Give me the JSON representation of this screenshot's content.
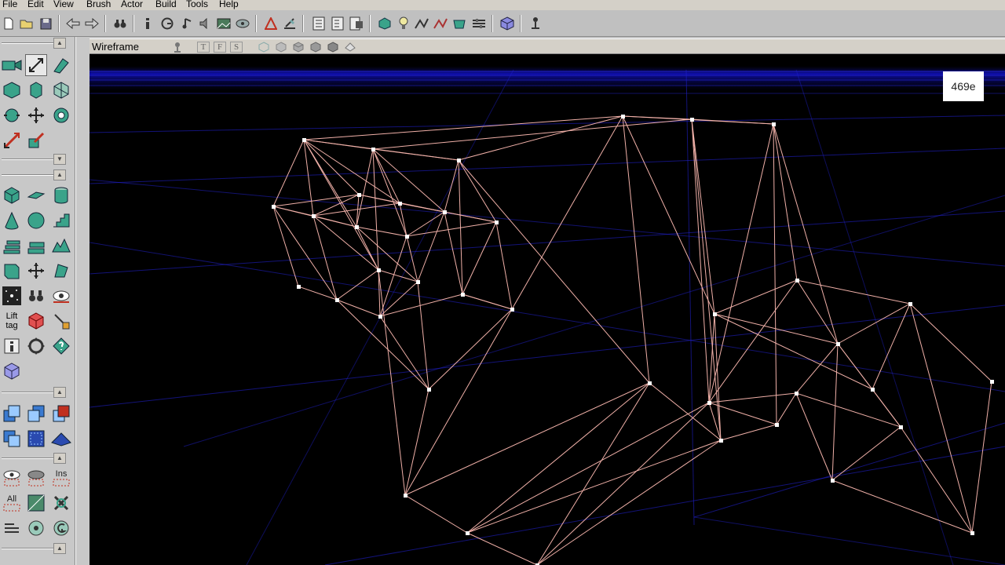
{
  "menu": {
    "items": [
      "File",
      "Edit",
      "View",
      "Brush",
      "Actor",
      "Build",
      "Tools",
      "Help"
    ]
  },
  "toolbar": {
    "icons": [
      "new-document-icon",
      "open-folder-icon",
      "save-disk-icon",
      "undo-arrow-icon",
      "redo-arrow-icon",
      "find-binoculars-icon",
      "info-icon",
      "group-browser-icon",
      "sound-browser-icon",
      "music-browser-icon",
      "texture-browser-icon",
      "mesh-browser-icon",
      "actor-class-icon",
      "brush-clip-icon",
      "properties-icon",
      "build-geometry-icon",
      "build-lighting-icon",
      "build-paths-icon",
      "build-changed-icon",
      "build-all-icon",
      "play-map-icon",
      "cube-browser-icon",
      "actor-pin-icon"
    ]
  },
  "left_panel": {
    "lift_tag_label_line1": "Lift",
    "lift_tag_label_line2": "tag",
    "ins_label": "Ins",
    "all_label": "All"
  },
  "viewport": {
    "title": "Wireframe",
    "view_buttons": [
      "T",
      "F",
      "S"
    ],
    "badge": "469e",
    "colors": {
      "background": "#000000",
      "grid": "#2020c8",
      "wire": "#f0b0a8",
      "vertex": "#ffffff"
    }
  }
}
